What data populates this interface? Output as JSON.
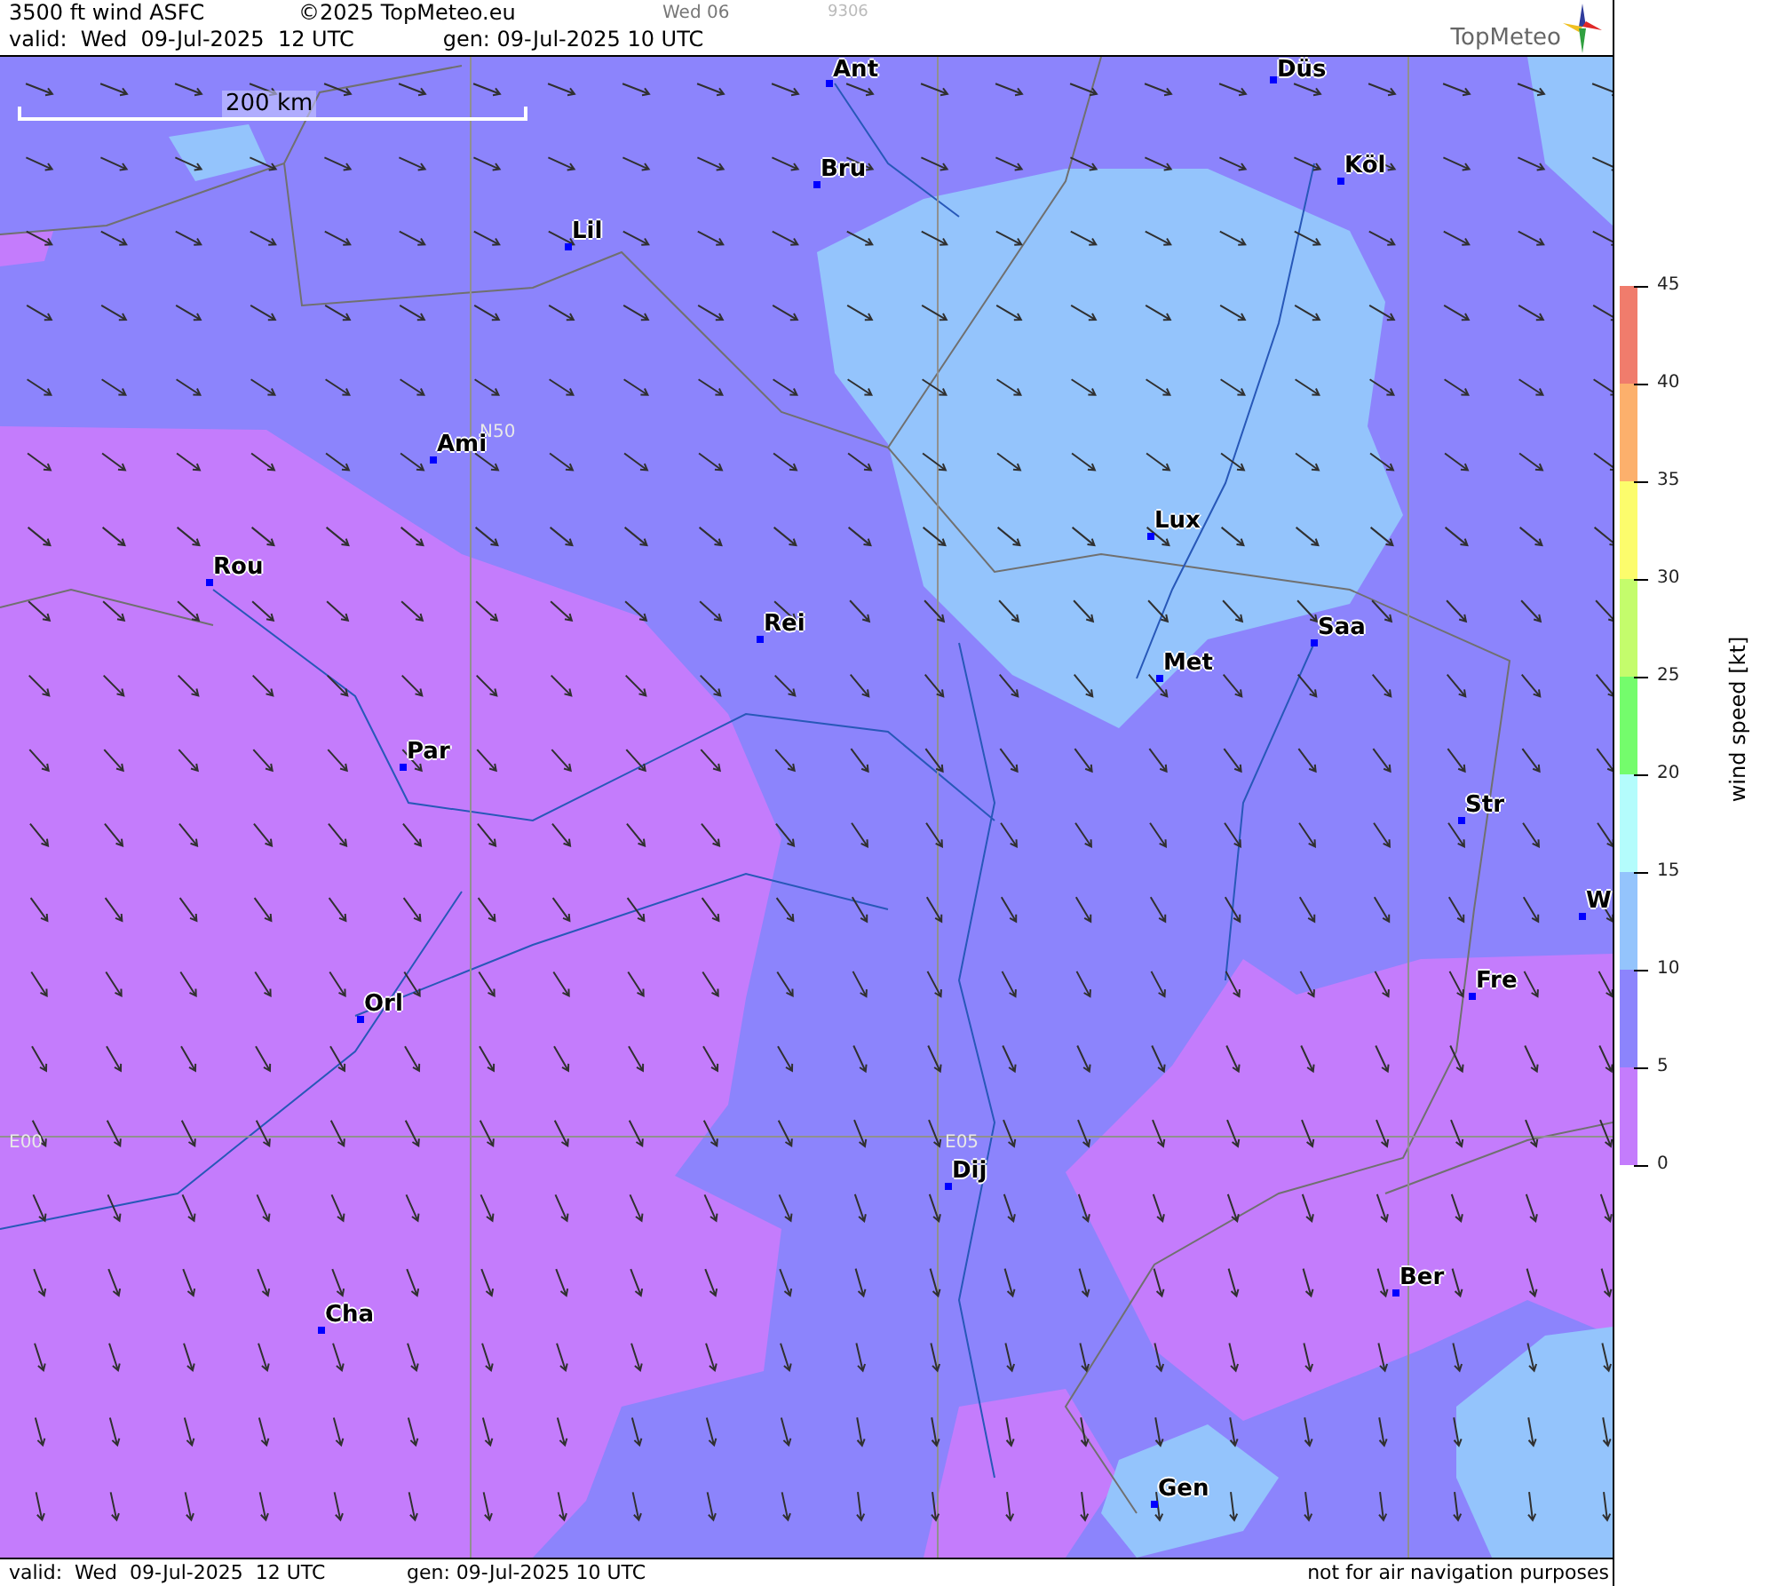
{
  "header": {
    "title": "3500 ft wind ASFC",
    "copyright": "©2025 TopMeteo.eu",
    "day_code": "Wed 06",
    "run_code": "9306",
    "valid": "valid:  Wed  09-Jul-2025  12 UTC",
    "generated": "gen: 09-Jul-2025 10 UTC",
    "logo": "TopMeteo"
  },
  "map": {
    "scale": "200 km",
    "grid_labels": [
      "N50",
      "E00",
      "E05"
    ],
    "cities": [
      "Ant",
      "Düs",
      "Bru",
      "Köl",
      "Lil",
      "Ami",
      "Lux",
      "Rou",
      "Rei",
      "Saa",
      "Met",
      "Par",
      "Str",
      "W",
      "Fre",
      "Orl",
      "Dij",
      "Ber",
      "Cha",
      "Gen"
    ]
  },
  "legend": {
    "title": "wind speed [kt]",
    "ticks": [
      "45",
      "40",
      "35",
      "30",
      "25",
      "20",
      "15",
      "10",
      "5",
      "0"
    ],
    "bands": [
      {
        "color": "#f07c6c"
      },
      {
        "color": "#fcb06c"
      },
      {
        "color": "#fcfc6c"
      },
      {
        "color": "#c4fc6c"
      },
      {
        "color": "#74fc6c"
      },
      {
        "color": "#b4fcfc"
      },
      {
        "color": "#94c4fc"
      },
      {
        "color": "#8c84fc"
      },
      {
        "color": "#c47cfc"
      }
    ]
  },
  "footer": {
    "valid": "valid:  Wed  09-Jul-2025  12 UTC",
    "generated": "gen: 09-Jul-2025 10 UTC",
    "notice": "not for air navigation purposes"
  }
}
